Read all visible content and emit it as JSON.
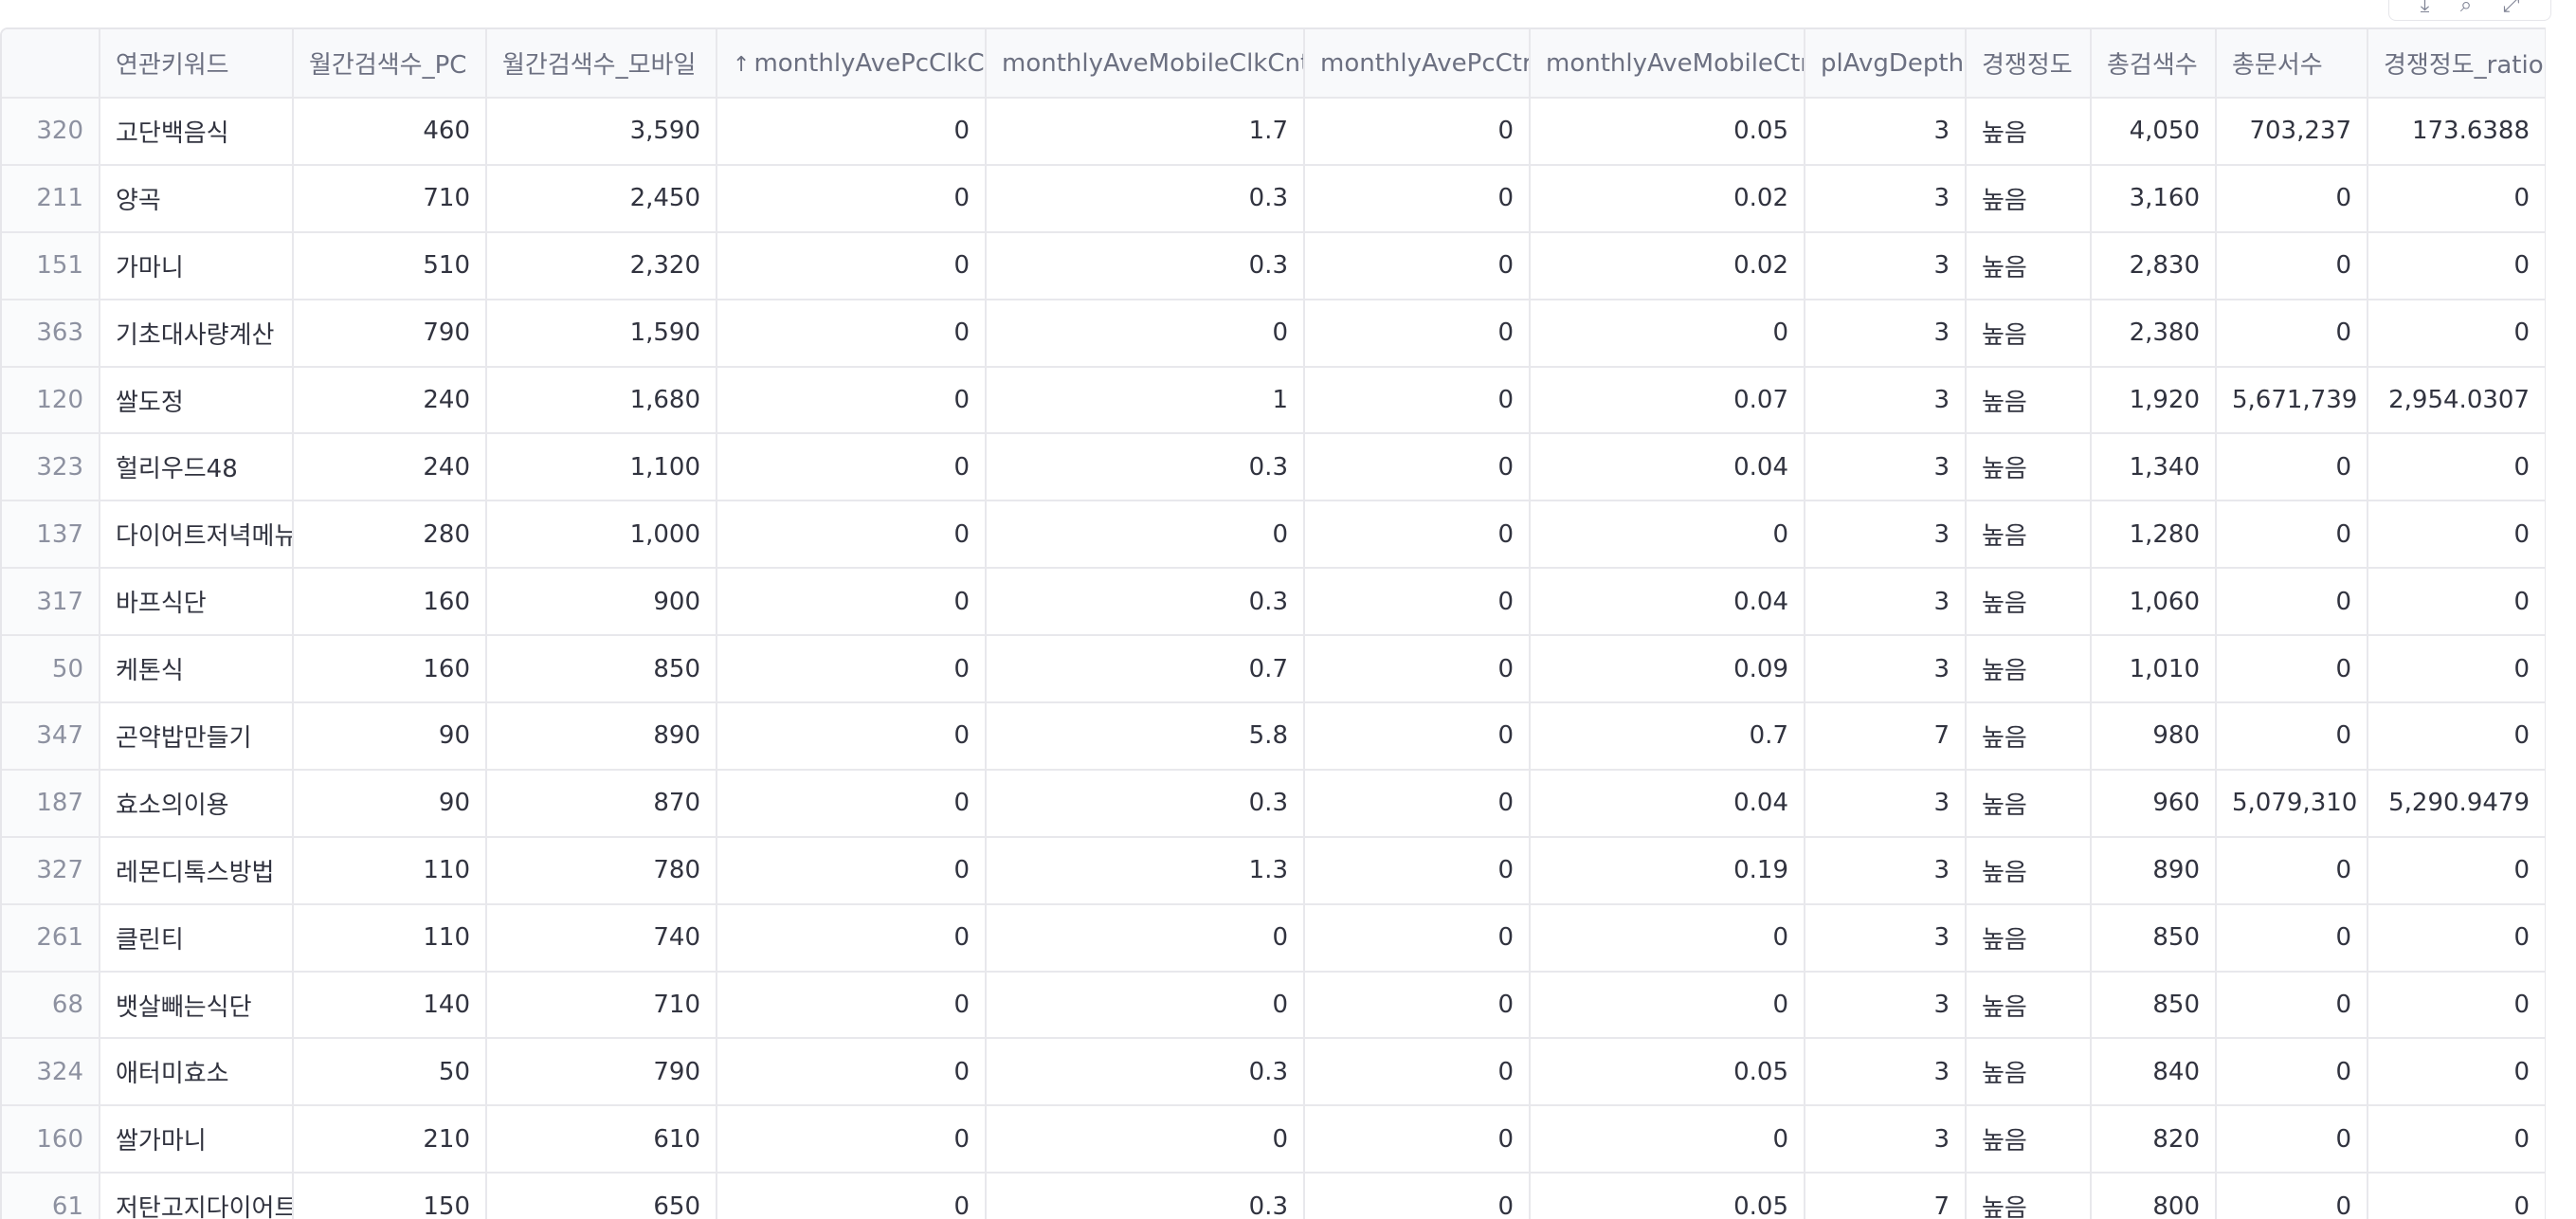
{
  "toolbar": {
    "icons": [
      "download-icon",
      "search-icon",
      "fullscreen-icon"
    ],
    "glyphs": [
      "⤓",
      "⌕",
      "⤢"
    ]
  },
  "table": {
    "sort_indicator": "↑",
    "columns": [
      {
        "key": "index",
        "label": ""
      },
      {
        "key": "keyword",
        "label": "연관키워드"
      },
      {
        "key": "pc",
        "label": "월간검색수_PC"
      },
      {
        "key": "mobile",
        "label": "월간검색수_모바일"
      },
      {
        "key": "pc_clk",
        "label": "monthlyAvePcClkCnt",
        "sorted": true
      },
      {
        "key": "mobile_clk",
        "label": "monthlyAveMobileClkCnt"
      },
      {
        "key": "pc_ctr",
        "label": "monthlyAvePcCtr"
      },
      {
        "key": "mobile_ctr",
        "label": "monthlyAveMobileCtr"
      },
      {
        "key": "depth",
        "label": "plAvgDepth"
      },
      {
        "key": "comp",
        "label": "경쟁정도"
      },
      {
        "key": "total",
        "label": "총검색수"
      },
      {
        "key": "docs",
        "label": "총문서수"
      },
      {
        "key": "ratio",
        "label": "경쟁정도_ratio"
      }
    ],
    "rows": [
      [
        "320",
        "고단백음식",
        "460",
        "3,590",
        "0",
        "1.7",
        "0",
        "0.05",
        "3",
        "높음",
        "4,050",
        "703,237",
        "173.6388"
      ],
      [
        "211",
        "양곡",
        "710",
        "2,450",
        "0",
        "0.3",
        "0",
        "0.02",
        "3",
        "높음",
        "3,160",
        "0",
        "0"
      ],
      [
        "151",
        "가마니",
        "510",
        "2,320",
        "0",
        "0.3",
        "0",
        "0.02",
        "3",
        "높음",
        "2,830",
        "0",
        "0"
      ],
      [
        "363",
        "기초대사량계산",
        "790",
        "1,590",
        "0",
        "0",
        "0",
        "0",
        "3",
        "높음",
        "2,380",
        "0",
        "0"
      ],
      [
        "120",
        "쌀도정",
        "240",
        "1,680",
        "0",
        "1",
        "0",
        "0.07",
        "3",
        "높음",
        "1,920",
        "5,671,739",
        "2,954.0307"
      ],
      [
        "323",
        "헐리우드48",
        "240",
        "1,100",
        "0",
        "0.3",
        "0",
        "0.04",
        "3",
        "높음",
        "1,340",
        "0",
        "0"
      ],
      [
        "137",
        "다이어트저녁메뉴",
        "280",
        "1,000",
        "0",
        "0",
        "0",
        "0",
        "3",
        "높음",
        "1,280",
        "0",
        "0"
      ],
      [
        "317",
        "바프식단",
        "160",
        "900",
        "0",
        "0.3",
        "0",
        "0.04",
        "3",
        "높음",
        "1,060",
        "0",
        "0"
      ],
      [
        "50",
        "케톤식",
        "160",
        "850",
        "0",
        "0.7",
        "0",
        "0.09",
        "3",
        "높음",
        "1,010",
        "0",
        "0"
      ],
      [
        "347",
        "곤약밥만들기",
        "90",
        "890",
        "0",
        "5.8",
        "0",
        "0.7",
        "7",
        "높음",
        "980",
        "0",
        "0"
      ],
      [
        "187",
        "효소의이용",
        "90",
        "870",
        "0",
        "0.3",
        "0",
        "0.04",
        "3",
        "높음",
        "960",
        "5,079,310",
        "5,290.9479"
      ],
      [
        "327",
        "레몬디톡스방법",
        "110",
        "780",
        "0",
        "1.3",
        "0",
        "0.19",
        "3",
        "높음",
        "890",
        "0",
        "0"
      ],
      [
        "261",
        "클린티",
        "110",
        "740",
        "0",
        "0",
        "0",
        "0",
        "3",
        "높음",
        "850",
        "0",
        "0"
      ],
      [
        "68",
        "뱃살빼는식단",
        "140",
        "710",
        "0",
        "0",
        "0",
        "0",
        "3",
        "높음",
        "850",
        "0",
        "0"
      ],
      [
        "324",
        "애터미효소",
        "50",
        "790",
        "0",
        "0.3",
        "0",
        "0.05",
        "3",
        "높음",
        "840",
        "0",
        "0"
      ],
      [
        "160",
        "쌀가마니",
        "210",
        "610",
        "0",
        "0",
        "0",
        "0",
        "3",
        "높음",
        "820",
        "0",
        "0"
      ],
      [
        "61",
        "저탄고지다이어트",
        "150",
        "650",
        "0",
        "0.3",
        "0",
        "0.05",
        "7",
        "높음",
        "800",
        "0",
        "0"
      ]
    ]
  }
}
